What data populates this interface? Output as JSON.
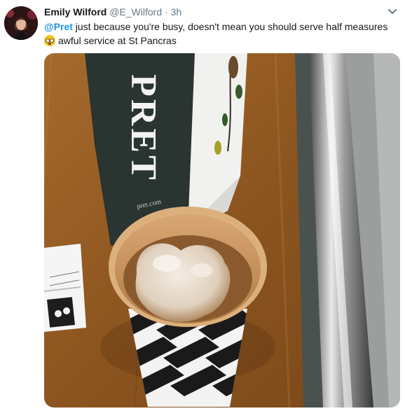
{
  "tweet": {
    "name": "Emily Wilford",
    "handle": "@E_Wilford",
    "separator": "·",
    "time": "3h",
    "mention": "@Pret",
    "text_line1": " just because you're busy, doesn't mean you should serve half measures",
    "text_line2": "awful service at St Pancras",
    "emoji": "flushed-face-emoji"
  },
  "photo": {
    "bag_lettering": "PRET",
    "bag_url": "pret.com"
  },
  "colors": {
    "name": "#14171a",
    "secondary": "#657786",
    "link": "#1b95e0"
  }
}
